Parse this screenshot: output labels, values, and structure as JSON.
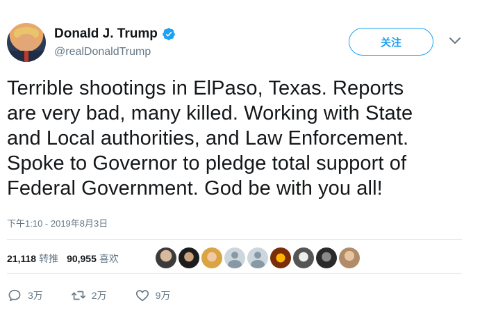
{
  "user": {
    "name": "Donald J. Trump",
    "handle": "@realDonaldTrump",
    "verified_color": "#1da1f2"
  },
  "follow_button": {
    "label": "关注"
  },
  "tweet": {
    "lines": [
      "Terrible shootings in ElPaso, Texas. Reports",
      "are very bad, many killed. Working with State",
      "and Local authorities, and Law Enforcement.",
      "Spoke to Governor to pledge total support of",
      "Federal Government. God be with you all!"
    ],
    "timestamp": "下午1:10 - 2019年8月3日"
  },
  "stats": {
    "retweets_count": "21,118",
    "retweets_label": "转推",
    "likes_count": "90,955",
    "likes_label": "喜欢"
  },
  "likers": [
    {
      "icon": "avatar-photo"
    },
    {
      "icon": "avatar-photo"
    },
    {
      "icon": "avatar-photo"
    },
    {
      "icon": "default-avatar-icon"
    },
    {
      "icon": "default-avatar-icon"
    },
    {
      "icon": "avatar-photo"
    },
    {
      "icon": "avatar-photo"
    },
    {
      "icon": "avatar-photo"
    },
    {
      "icon": "avatar-photo"
    }
  ],
  "actions": {
    "reply_count": "3万",
    "retweet_count": "2万",
    "like_count": "9万"
  },
  "colors": {
    "accent": "#1da1f2",
    "text": "#14171a",
    "muted": "#657786",
    "divider": "#e6ecf0"
  }
}
